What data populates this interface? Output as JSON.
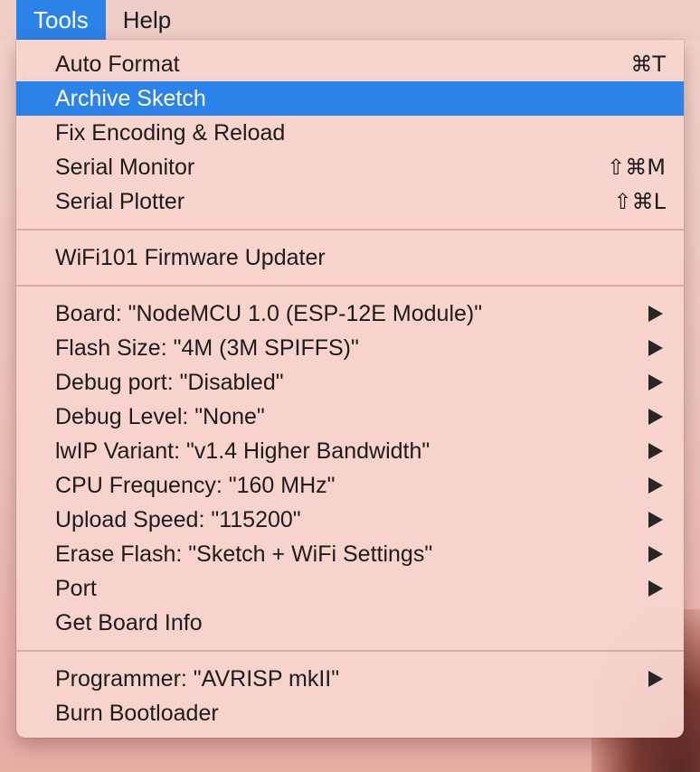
{
  "menubar": {
    "items": [
      {
        "label": "Tools",
        "active": true
      },
      {
        "label": "Help",
        "active": false
      }
    ]
  },
  "menu": {
    "groups": [
      [
        {
          "label": "Auto Format",
          "shortcut": "⌘T"
        },
        {
          "label": "Archive Sketch",
          "highlighted": true
        },
        {
          "label": "Fix Encoding & Reload"
        },
        {
          "label": "Serial Monitor",
          "shortcut": "⇧⌘M"
        },
        {
          "label": "Serial Plotter",
          "shortcut": "⇧⌘L"
        }
      ],
      [
        {
          "label": "WiFi101 Firmware Updater"
        }
      ],
      [
        {
          "label": "Board: \"NodeMCU 1.0 (ESP-12E Module)\"",
          "submenu": true
        },
        {
          "label": "Flash Size: \"4M (3M SPIFFS)\"",
          "submenu": true
        },
        {
          "label": "Debug port: \"Disabled\"",
          "submenu": true
        },
        {
          "label": "Debug Level: \"None\"",
          "submenu": true
        },
        {
          "label": "lwIP Variant: \"v1.4 Higher Bandwidth\"",
          "submenu": true
        },
        {
          "label": "CPU Frequency: \"160 MHz\"",
          "submenu": true
        },
        {
          "label": "Upload Speed: \"115200\"",
          "submenu": true
        },
        {
          "label": "Erase Flash: \"Sketch + WiFi Settings\"",
          "submenu": true
        },
        {
          "label": "Port",
          "submenu": true
        },
        {
          "label": "Get Board Info"
        }
      ],
      [
        {
          "label": "Programmer: \"AVRISP mkII\"",
          "submenu": true
        },
        {
          "label": "Burn Bootloader"
        }
      ]
    ]
  },
  "colors": {
    "highlight": "#2b82e8",
    "highlight_text": "#ffffff",
    "menu_text": "#1c1c1c"
  },
  "icons": {
    "submenu": "submenu-arrow-icon"
  }
}
